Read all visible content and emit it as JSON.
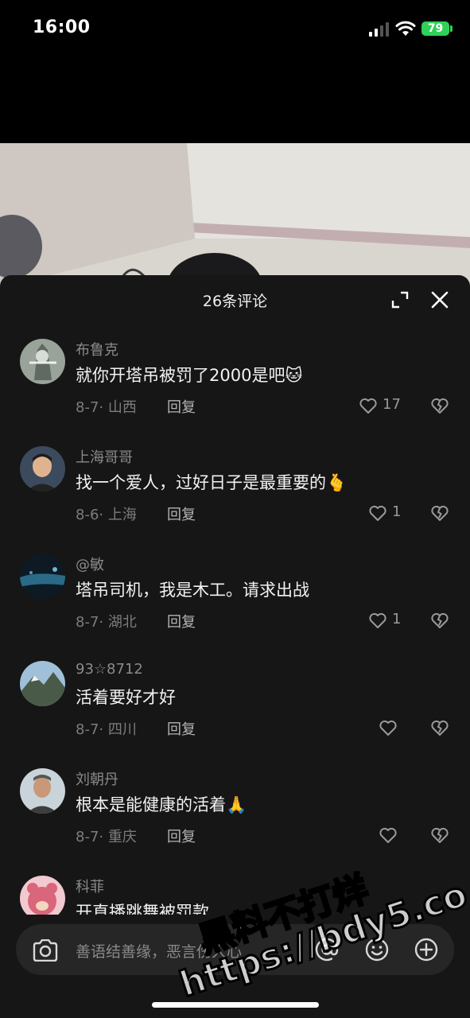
{
  "status_bar": {
    "time": "16:00",
    "battery": "79"
  },
  "sheet": {
    "title": "26条评论"
  },
  "comments": [
    {
      "user": "布鲁克",
      "text": "就你开塔吊被罚了2000是吧",
      "emoji": "🐱",
      "date": "8-7",
      "location": "山西",
      "reply": "回复",
      "likes": "17"
    },
    {
      "user": "上海哥哥",
      "text": "找一个爱人，过好日子是最重要的",
      "emoji": "🫰",
      "date": "8-6",
      "location": "上海",
      "reply": "回复",
      "likes": "1"
    },
    {
      "user": "@敏",
      "text": "塔吊司机，我是木工。请求出战",
      "emoji": "",
      "date": "8-7",
      "location": "湖北",
      "reply": "回复",
      "likes": "1"
    },
    {
      "user": "93☆8712",
      "text": "活着要好才好",
      "emoji": "",
      "date": "8-7",
      "location": "四川",
      "reply": "回复",
      "likes": ""
    },
    {
      "user": "刘朝丹",
      "text": "根本是能健康的活着",
      "emoji": "🙏",
      "date": "8-7",
      "location": "重庆",
      "reply": "回复",
      "likes": ""
    },
    {
      "user": "科菲",
      "text": "开直播跳舞被罚款",
      "emoji": "",
      "date": "",
      "location": "",
      "reply": "",
      "likes": ""
    }
  ],
  "input": {
    "placeholder": "善语结善缘，恶言伤人心"
  },
  "watermark": {
    "line1": "黑料不打烊",
    "line2": "https://bdy5.co"
  },
  "colors": {
    "sheet_bg": "#161616",
    "battery": "#30d158",
    "username": "#8a8a8a"
  },
  "icons": [
    "expand-icon",
    "close-icon",
    "heart-icon",
    "broken-heart-icon",
    "camera-icon",
    "at-icon",
    "emoji-icon",
    "plus-icon"
  ]
}
